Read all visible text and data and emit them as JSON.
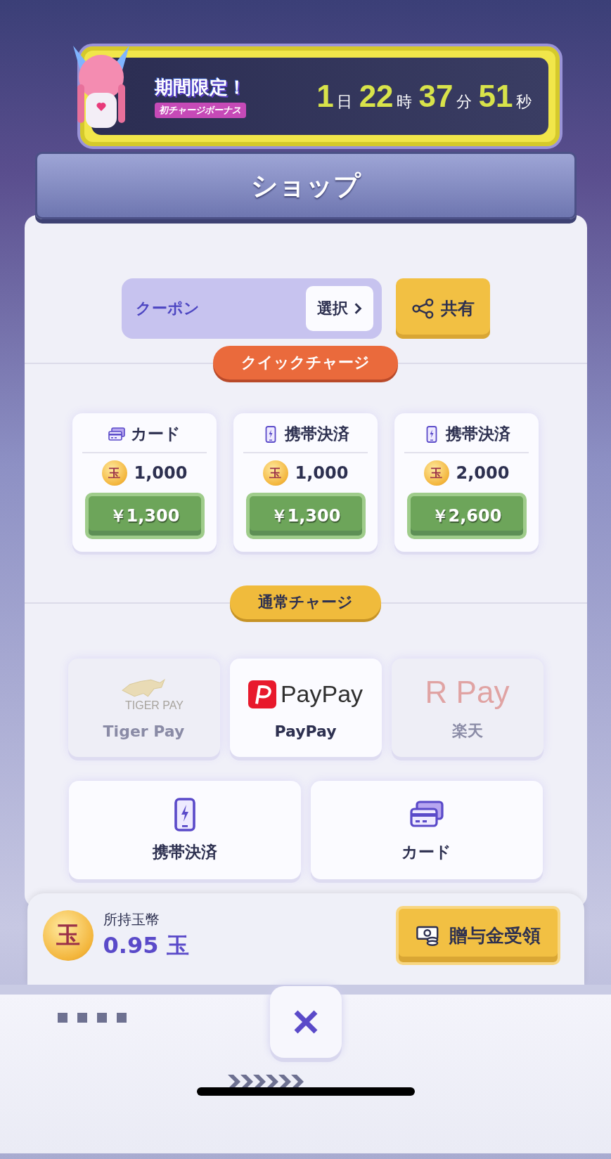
{
  "banner": {
    "headline": "期間限定！",
    "subtitle": "初チャージボーナス",
    "countdown": [
      {
        "value": "1",
        "unit": "日"
      },
      {
        "value": "22",
        "unit": "時"
      },
      {
        "value": "37",
        "unit": "分"
      },
      {
        "value": "51",
        "unit": "秒"
      }
    ]
  },
  "title": "ショップ",
  "coupon": {
    "label": "クーポン",
    "button": "選択"
  },
  "share_button": "共有",
  "quick_charge": {
    "heading": "クイックチャージ",
    "items": [
      {
        "kind": "card",
        "method": "カード",
        "coin_glyph": "玉",
        "amount": "1,000",
        "price": "￥1,300"
      },
      {
        "kind": "mobile",
        "method": "携帯決済",
        "coin_glyph": "玉",
        "amount": "1,000",
        "price": "￥1,300"
      },
      {
        "kind": "mobile",
        "method": "携帯決済",
        "coin_glyph": "玉",
        "amount": "2,000",
        "price": "￥2,600"
      }
    ]
  },
  "normal_charge": {
    "heading": "通常チャージ",
    "providers": [
      {
        "kind": "tigerpay",
        "logo_text": "TIGER PAY",
        "label": "Tiger Pay",
        "disabled": true
      },
      {
        "kind": "paypay",
        "logo_text": "PayPay",
        "label": "PayPay",
        "disabled": false
      },
      {
        "kind": "rpay",
        "logo_text": "R Pay",
        "label": "楽天",
        "disabled": true
      }
    ],
    "methods": [
      {
        "kind": "mobile",
        "label": "携帯決済"
      },
      {
        "kind": "card",
        "label": "カード"
      }
    ]
  },
  "balance": {
    "coin_glyph": "玉",
    "label": "所持玉幣",
    "value": "0.95 玉"
  },
  "gift_button": "贈与金受領"
}
